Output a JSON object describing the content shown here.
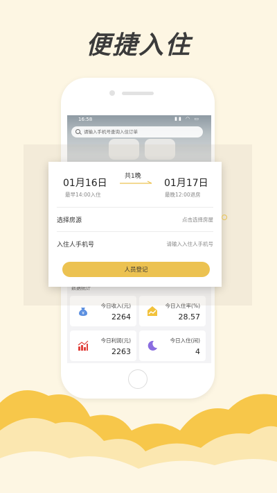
{
  "headline": "便捷入住",
  "phone": {
    "status_time": "16:58",
    "status_icons": "▮▮ ◠ ▭",
    "search_placeholder": "请输入手机号查询入住订单"
  },
  "booking": {
    "checkin_date": "01月16日",
    "checkin_note": "最早14:00入住",
    "nights": "共1晚",
    "checkout_date": "01月17日",
    "checkout_note": "最晚12:00退房",
    "room_label": "选择房源",
    "room_value": "点击选择房屋",
    "phone_label": "入住人手机号",
    "phone_placeholder": "请输入入住人手机号",
    "register_button": "人员登记"
  },
  "stats": {
    "title": "数据统计",
    "cards": [
      {
        "label": "今日收入(元)",
        "value": "2264",
        "icon": "money-bag-icon",
        "color": "#5b8fe0"
      },
      {
        "label": "今日入住率(%)",
        "value": "28.57",
        "icon": "house-chart-icon",
        "color": "#f2c23b"
      },
      {
        "label": "今日利润(元)",
        "value": "2263",
        "icon": "bar-chart-icon",
        "color": "#e0413c"
      },
      {
        "label": "今日入住(间)",
        "value": "4",
        "icon": "moon-icon",
        "color": "#8a6de0"
      }
    ]
  },
  "colors": {
    "accent": "#ecc251",
    "background": "#fdf6e3",
    "cloud_dark": "#f7c74a",
    "cloud_light": "#fbe7b0"
  }
}
